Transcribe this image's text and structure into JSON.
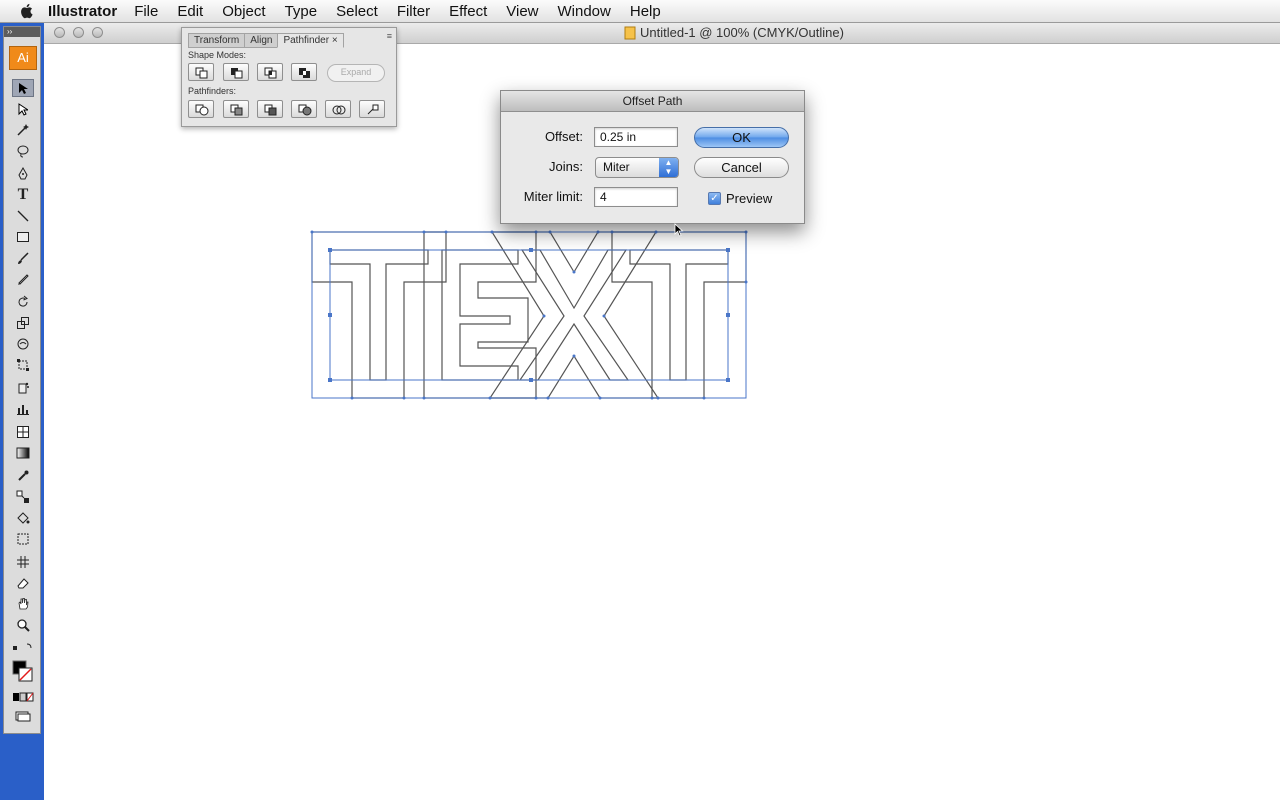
{
  "menubar": {
    "app": "Illustrator",
    "items": [
      "File",
      "Edit",
      "Object",
      "Type",
      "Select",
      "Filter",
      "Effect",
      "View",
      "Window",
      "Help"
    ]
  },
  "document": {
    "title": "Untitled-1 @ 100% (CMYK/Outline)"
  },
  "toolbox": {
    "logo": "Ai",
    "grip": "››",
    "tools": [
      "selection-tool",
      "direct-selection-tool",
      "magic-wand-tool",
      "lasso-tool",
      "pen-tool",
      "type-tool",
      "line-tool",
      "rectangle-tool",
      "paintbrush-tool",
      "pencil-tool",
      "rotate-tool",
      "scale-tool",
      "warp-tool",
      "free-transform-tool",
      "symbol-sprayer-tool",
      "column-graph-tool",
      "mesh-tool",
      "gradient-tool",
      "eyedropper-tool",
      "blend-tool",
      "live-paint-bucket-tool",
      "live-paint-selection-tool",
      "slice-tool",
      "eraser-tool",
      "hand-tool",
      "zoom-tool"
    ]
  },
  "pathfinder_panel": {
    "tabs": [
      "Transform",
      "Align",
      "Pathfinder"
    ],
    "active_tab": "Pathfinder",
    "tab_close": "×",
    "shape_modes_label": "Shape Modes:",
    "pathfinders_label": "Pathfinders:",
    "expand_label": "Expand"
  },
  "offset_dialog": {
    "title": "Offset Path",
    "offset_label": "Offset:",
    "offset_value": "0.25 in",
    "joins_label": "Joins:",
    "joins_value": "Miter",
    "miter_label": "Miter limit:",
    "miter_value": "4",
    "ok_label": "OK",
    "cancel_label": "Cancel",
    "preview_label": "Preview",
    "preview_checked": true
  },
  "artwork": {
    "text": "TEXT",
    "selection_color": "#4a76c8"
  }
}
